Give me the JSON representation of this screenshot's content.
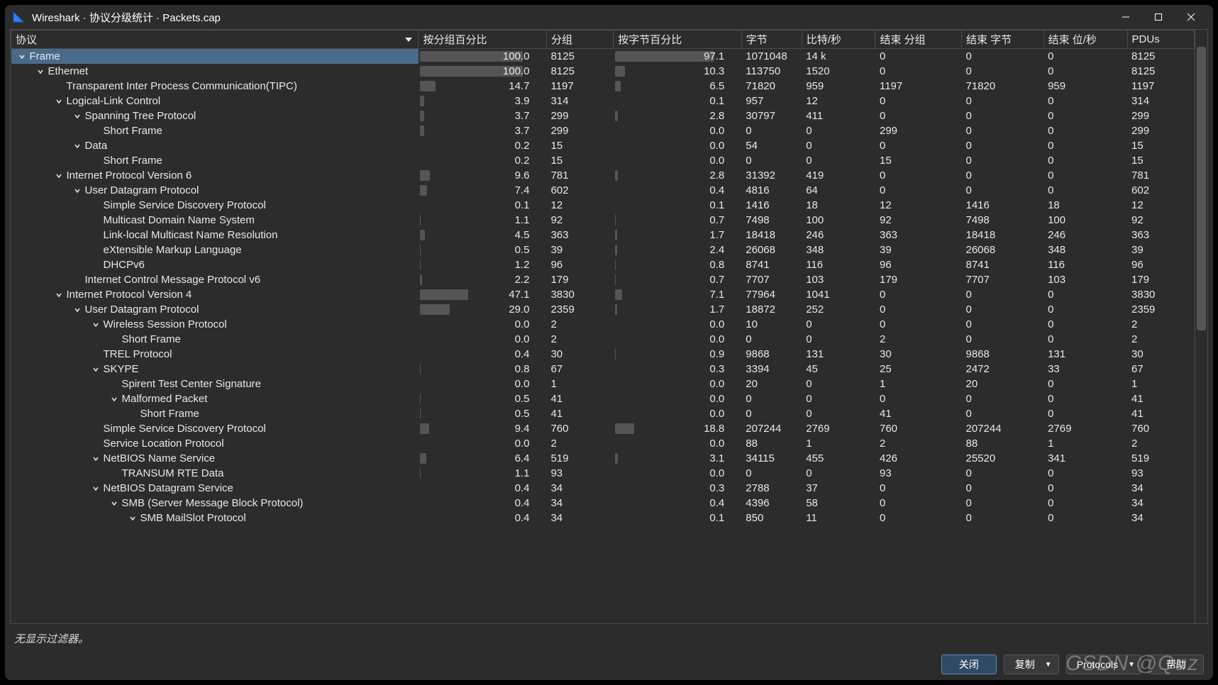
{
  "window_title": "Wireshark · 协议分级统计 · Packets.cap",
  "columns": [
    "协议",
    "按分组百分比",
    "分组",
    "按字节百分比",
    "字节",
    "比特/秒",
    "结束 分组",
    "结束 字节",
    "结束 位/秒",
    "PDUs"
  ],
  "status": "无显示过滤器。",
  "buttons": {
    "close": "关闭",
    "copy": "复制",
    "protocols": "Protocols",
    "help": "帮助"
  },
  "watermark": "CSDN @Quz",
  "rows": [
    {
      "indent": 0,
      "arrow": "down",
      "name": "Frame",
      "selected": true,
      "pctPkt": "100.0",
      "pkt": "8125",
      "pctByte": "97.1",
      "bytes": "1071048",
      "bits": "14 k",
      "ep": "0",
      "eb": "0",
      "ebs": "0",
      "pdu": "8125",
      "barA": 100,
      "barB": 97
    },
    {
      "indent": 1,
      "arrow": "down",
      "name": "Ethernet",
      "pctPkt": "100.0",
      "pkt": "8125",
      "pctByte": "10.3",
      "bytes": "113750",
      "bits": "1520",
      "ep": "0",
      "eb": "0",
      "ebs": "0",
      "pdu": "8125",
      "barA": 100,
      "barB": 10
    },
    {
      "indent": 2,
      "arrow": "none",
      "name": "Transparent Inter Process Communication(TIPC)",
      "pctPkt": "14.7",
      "pkt": "1197",
      "pctByte": "6.5",
      "bytes": "71820",
      "bits": "959",
      "ep": "1197",
      "eb": "71820",
      "ebs": "959",
      "pdu": "1197",
      "barA": 15,
      "barB": 6
    },
    {
      "indent": 2,
      "arrow": "down",
      "name": "Logical-Link Control",
      "pctPkt": "3.9",
      "pkt": "314",
      "pctByte": "0.1",
      "bytes": "957",
      "bits": "12",
      "ep": "0",
      "eb": "0",
      "ebs": "0",
      "pdu": "314",
      "barA": 4,
      "barB": 0
    },
    {
      "indent": 3,
      "arrow": "down",
      "name": "Spanning Tree Protocol",
      "pctPkt": "3.7",
      "pkt": "299",
      "pctByte": "2.8",
      "bytes": "30797",
      "bits": "411",
      "ep": "0",
      "eb": "0",
      "ebs": "0",
      "pdu": "299",
      "barA": 4,
      "barB": 3
    },
    {
      "indent": 4,
      "arrow": "none",
      "name": "Short Frame",
      "pctPkt": "3.7",
      "pkt": "299",
      "pctByte": "0.0",
      "bytes": "0",
      "bits": "0",
      "ep": "299",
      "eb": "0",
      "ebs": "0",
      "pdu": "299",
      "barA": 4,
      "barB": 0
    },
    {
      "indent": 3,
      "arrow": "down",
      "name": "Data",
      "pctPkt": "0.2",
      "pkt": "15",
      "pctByte": "0.0",
      "bytes": "54",
      "bits": "0",
      "ep": "0",
      "eb": "0",
      "ebs": "0",
      "pdu": "15",
      "barA": 0,
      "barB": 0
    },
    {
      "indent": 4,
      "arrow": "none",
      "name": "Short Frame",
      "pctPkt": "0.2",
      "pkt": "15",
      "pctByte": "0.0",
      "bytes": "0",
      "bits": "0",
      "ep": "15",
      "eb": "0",
      "ebs": "0",
      "pdu": "15",
      "barA": 0,
      "barB": 0
    },
    {
      "indent": 2,
      "arrow": "down",
      "name": "Internet Protocol Version 6",
      "pctPkt": "9.6",
      "pkt": "781",
      "pctByte": "2.8",
      "bytes": "31392",
      "bits": "419",
      "ep": "0",
      "eb": "0",
      "ebs": "0",
      "pdu": "781",
      "barA": 10,
      "barB": 3
    },
    {
      "indent": 3,
      "arrow": "down",
      "name": "User Datagram Protocol",
      "pctPkt": "7.4",
      "pkt": "602",
      "pctByte": "0.4",
      "bytes": "4816",
      "bits": "64",
      "ep": "0",
      "eb": "0",
      "ebs": "0",
      "pdu": "602",
      "barA": 7,
      "barB": 0
    },
    {
      "indent": 4,
      "arrow": "none",
      "name": "Simple Service Discovery Protocol",
      "pctPkt": "0.1",
      "pkt": "12",
      "pctByte": "0.1",
      "bytes": "1416",
      "bits": "18",
      "ep": "12",
      "eb": "1416",
      "ebs": "18",
      "pdu": "12",
      "barA": 0,
      "barB": 0
    },
    {
      "indent": 4,
      "arrow": "none",
      "name": "Multicast Domain Name System",
      "pctPkt": "1.1",
      "pkt": "92",
      "pctByte": "0.7",
      "bytes": "7498",
      "bits": "100",
      "ep": "92",
      "eb": "7498",
      "ebs": "100",
      "pdu": "92",
      "barA": 1,
      "barB": 1
    },
    {
      "indent": 4,
      "arrow": "none",
      "name": "Link-local Multicast Name Resolution",
      "pctPkt": "4.5",
      "pkt": "363",
      "pctByte": "1.7",
      "bytes": "18418",
      "bits": "246",
      "ep": "363",
      "eb": "18418",
      "ebs": "246",
      "pdu": "363",
      "barA": 5,
      "barB": 2
    },
    {
      "indent": 4,
      "arrow": "none",
      "name": "eXtensible Markup Language",
      "pctPkt": "0.5",
      "pkt": "39",
      "pctByte": "2.4",
      "bytes": "26068",
      "bits": "348",
      "ep": "39",
      "eb": "26068",
      "ebs": "348",
      "pdu": "39",
      "barA": 1,
      "barB": 2
    },
    {
      "indent": 4,
      "arrow": "none",
      "name": "DHCPv6",
      "pctPkt": "1.2",
      "pkt": "96",
      "pctByte": "0.8",
      "bytes": "8741",
      "bits": "116",
      "ep": "96",
      "eb": "8741",
      "ebs": "116",
      "pdu": "96",
      "barA": 1,
      "barB": 1
    },
    {
      "indent": 3,
      "arrow": "none",
      "name": "Internet Control Message Protocol v6",
      "pctPkt": "2.2",
      "pkt": "179",
      "pctByte": "0.7",
      "bytes": "7707",
      "bits": "103",
      "ep": "179",
      "eb": "7707",
      "ebs": "103",
      "pdu": "179",
      "barA": 2,
      "barB": 1
    },
    {
      "indent": 2,
      "arrow": "down",
      "name": "Internet Protocol Version 4",
      "pctPkt": "47.1",
      "pkt": "3830",
      "pctByte": "7.1",
      "bytes": "77964",
      "bits": "1041",
      "ep": "0",
      "eb": "0",
      "ebs": "0",
      "pdu": "3830",
      "barA": 47,
      "barB": 7
    },
    {
      "indent": 3,
      "arrow": "down",
      "name": "User Datagram Protocol",
      "pctPkt": "29.0",
      "pkt": "2359",
      "pctByte": "1.7",
      "bytes": "18872",
      "bits": "252",
      "ep": "0",
      "eb": "0",
      "ebs": "0",
      "pdu": "2359",
      "barA": 29,
      "barB": 2
    },
    {
      "indent": 4,
      "arrow": "down",
      "name": "Wireless Session Protocol",
      "pctPkt": "0.0",
      "pkt": "2",
      "pctByte": "0.0",
      "bytes": "10",
      "bits": "0",
      "ep": "0",
      "eb": "0",
      "ebs": "0",
      "pdu": "2",
      "barA": 0,
      "barB": 0
    },
    {
      "indent": 5,
      "arrow": "none",
      "name": "Short Frame",
      "pctPkt": "0.0",
      "pkt": "2",
      "pctByte": "0.0",
      "bytes": "0",
      "bits": "0",
      "ep": "2",
      "eb": "0",
      "ebs": "0",
      "pdu": "2",
      "barA": 0,
      "barB": 0
    },
    {
      "indent": 4,
      "arrow": "none",
      "name": "TREL Protocol",
      "pctPkt": "0.4",
      "pkt": "30",
      "pctByte": "0.9",
      "bytes": "9868",
      "bits": "131",
      "ep": "30",
      "eb": "9868",
      "ebs": "131",
      "pdu": "30",
      "barA": 0,
      "barB": 1
    },
    {
      "indent": 4,
      "arrow": "down",
      "name": "SKYPE",
      "pctPkt": "0.8",
      "pkt": "67",
      "pctByte": "0.3",
      "bytes": "3394",
      "bits": "45",
      "ep": "25",
      "eb": "2472",
      "ebs": "33",
      "pdu": "67",
      "barA": 1,
      "barB": 0
    },
    {
      "indent": 5,
      "arrow": "none",
      "name": "Spirent Test Center Signature",
      "pctPkt": "0.0",
      "pkt": "1",
      "pctByte": "0.0",
      "bytes": "20",
      "bits": "0",
      "ep": "1",
      "eb": "20",
      "ebs": "0",
      "pdu": "1",
      "barA": 0,
      "barB": 0
    },
    {
      "indent": 5,
      "arrow": "down",
      "name": "Malformed Packet",
      "pctPkt": "0.5",
      "pkt": "41",
      "pctByte": "0.0",
      "bytes": "0",
      "bits": "0",
      "ep": "0",
      "eb": "0",
      "ebs": "0",
      "pdu": "41",
      "barA": 1,
      "barB": 0
    },
    {
      "indent": 6,
      "arrow": "none",
      "name": "Short Frame",
      "pctPkt": "0.5",
      "pkt": "41",
      "pctByte": "0.0",
      "bytes": "0",
      "bits": "0",
      "ep": "41",
      "eb": "0",
      "ebs": "0",
      "pdu": "41",
      "barA": 1,
      "barB": 0
    },
    {
      "indent": 4,
      "arrow": "none",
      "name": "Simple Service Discovery Protocol",
      "pctPkt": "9.4",
      "pkt": "760",
      "pctByte": "18.8",
      "bytes": "207244",
      "bits": "2769",
      "ep": "760",
      "eb": "207244",
      "ebs": "2769",
      "pdu": "760",
      "barA": 9,
      "barB": 19
    },
    {
      "indent": 4,
      "arrow": "none",
      "name": "Service Location Protocol",
      "pctPkt": "0.0",
      "pkt": "2",
      "pctByte": "0.0",
      "bytes": "88",
      "bits": "1",
      "ep": "2",
      "eb": "88",
      "ebs": "1",
      "pdu": "2",
      "barA": 0,
      "barB": 0
    },
    {
      "indent": 4,
      "arrow": "down",
      "name": "NetBIOS Name Service",
      "pctPkt": "6.4",
      "pkt": "519",
      "pctByte": "3.1",
      "bytes": "34115",
      "bits": "455",
      "ep": "426",
      "eb": "25520",
      "ebs": "341",
      "pdu": "519",
      "barA": 6,
      "barB": 3
    },
    {
      "indent": 5,
      "arrow": "none",
      "name": "TRANSUM RTE Data",
      "pctPkt": "1.1",
      "pkt": "93",
      "pctByte": "0.0",
      "bytes": "0",
      "bits": "0",
      "ep": "93",
      "eb": "0",
      "ebs": "0",
      "pdu": "93",
      "barA": 1,
      "barB": 0
    },
    {
      "indent": 4,
      "arrow": "down",
      "name": "NetBIOS Datagram Service",
      "pctPkt": "0.4",
      "pkt": "34",
      "pctByte": "0.3",
      "bytes": "2788",
      "bits": "37",
      "ep": "0",
      "eb": "0",
      "ebs": "0",
      "pdu": "34",
      "barA": 0,
      "barB": 0
    },
    {
      "indent": 5,
      "arrow": "down",
      "name": "SMB (Server Message Block Protocol)",
      "pctPkt": "0.4",
      "pkt": "34",
      "pctByte": "0.4",
      "bytes": "4396",
      "bits": "58",
      "ep": "0",
      "eb": "0",
      "ebs": "0",
      "pdu": "34",
      "barA": 0,
      "barB": 0
    },
    {
      "indent": 6,
      "arrow": "down",
      "name": "SMB MailSlot Protocol",
      "pctPkt": "0.4",
      "pkt": "34",
      "pctByte": "0.1",
      "bytes": "850",
      "bits": "11",
      "ep": "0",
      "eb": "0",
      "ebs": "0",
      "pdu": "34",
      "barA": 0,
      "barB": 0
    }
  ]
}
